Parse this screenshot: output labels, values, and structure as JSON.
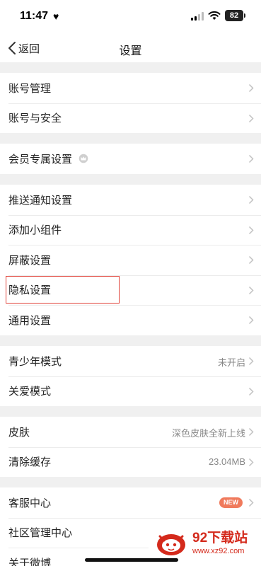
{
  "status_bar": {
    "time": "11:47",
    "battery": "82"
  },
  "nav": {
    "back_label": "返回",
    "title": "设置"
  },
  "sections": [
    {
      "items": [
        {
          "label": "账号管理"
        },
        {
          "label": "账号与安全"
        }
      ]
    },
    {
      "items": [
        {
          "label": "会员专属设置",
          "icon": "crown-icon"
        }
      ]
    },
    {
      "items": [
        {
          "label": "推送通知设置"
        },
        {
          "label": "添加小组件"
        },
        {
          "label": "屏蔽设置"
        },
        {
          "label": "隐私设置",
          "highlighted": true
        },
        {
          "label": "通用设置"
        }
      ]
    },
    {
      "items": [
        {
          "label": "青少年模式",
          "value": "未开启"
        },
        {
          "label": "关爱模式"
        }
      ]
    },
    {
      "items": [
        {
          "label": "皮肤",
          "value": "深色皮肤全新上线"
        },
        {
          "label": "清除缓存",
          "value": "23.04MB"
        }
      ]
    },
    {
      "items": [
        {
          "label": "客服中心",
          "badge": "NEW"
        },
        {
          "label": "社区管理中心"
        },
        {
          "label": "关于微博"
        }
      ]
    }
  ],
  "watermark": {
    "title": "92下载站",
    "url": "www.xz92.com"
  },
  "colors": {
    "highlight": "#e0433a",
    "badge": "#f07a5c",
    "watermark": "#d42a1c"
  }
}
